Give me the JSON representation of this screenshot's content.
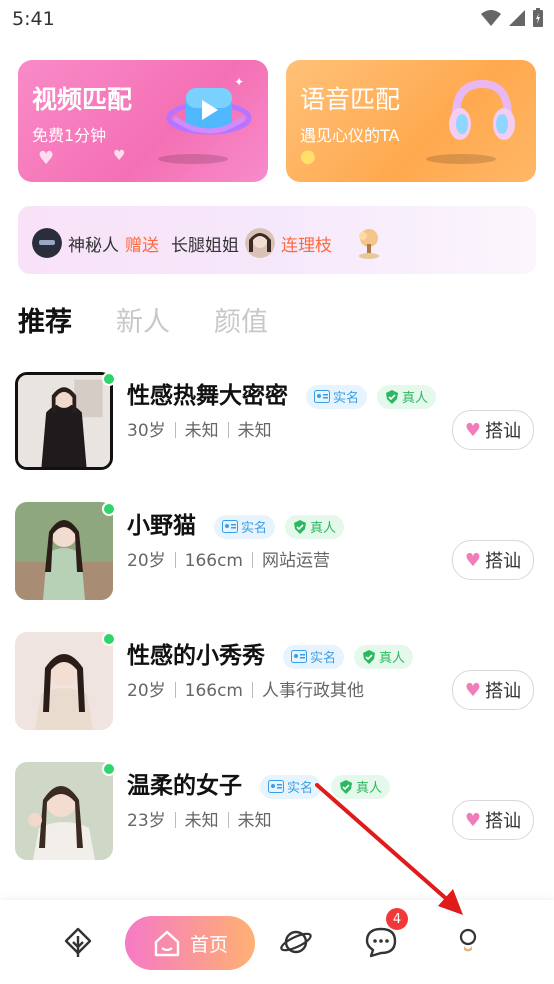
{
  "status_bar": {
    "time": "5:41"
  },
  "cards": {
    "video": {
      "title": "视频匹配",
      "subtitle": "免费1分钟"
    },
    "voice": {
      "title": "语音匹配",
      "subtitle": "遇见心仪的TA"
    }
  },
  "gift_banner": {
    "sender": "神秘人",
    "action": "赠送",
    "receiver": "长腿姐姐",
    "gift": "连理枝"
  },
  "tabs": [
    {
      "label": "推荐",
      "active": true
    },
    {
      "label": "新人",
      "active": false
    },
    {
      "label": "颜值",
      "active": false
    }
  ],
  "users": [
    {
      "name": "性感热舞大密密",
      "age": "30岁",
      "height": "未知",
      "job": "未知"
    },
    {
      "name": "小野猫",
      "age": "20岁",
      "height": "166cm",
      "job": "网站运营"
    },
    {
      "name": "性感的小秀秀",
      "age": "20岁",
      "height": "166cm",
      "job": "人事行政其他"
    },
    {
      "name": "温柔的女子",
      "age": "23岁",
      "height": "未知",
      "job": "未知"
    }
  ],
  "badges": {
    "real_name": "实名",
    "verified": "真人"
  },
  "chat_button_label": "搭讪",
  "bottom_nav": {
    "home_label": "首页",
    "message_count": "4"
  },
  "colors": {
    "video_card": "#f470b4",
    "voice_card": "#ffa94f",
    "accent_orange": "#ff6a3d",
    "online": "#2fd46a",
    "annotation_arrow": "#e01b1b"
  }
}
